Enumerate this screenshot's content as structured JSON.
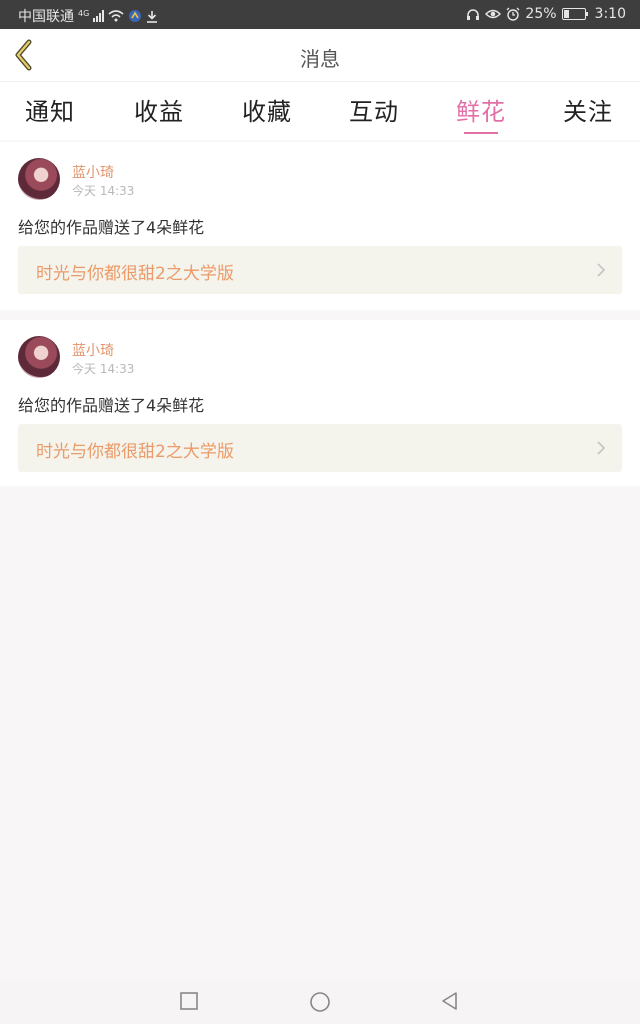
{
  "status_bar": {
    "carrier": "中国联通",
    "network": "4G",
    "battery_percent": "25%",
    "time": "3:10",
    "icons": [
      "signal-icon",
      "wifi-icon",
      "app-icon",
      "download-icon",
      "headphone-icon",
      "eye-icon",
      "alarm-icon",
      "battery-icon"
    ]
  },
  "header": {
    "title": "消息",
    "back_icon": "back-arrow-icon"
  },
  "tabs": [
    {
      "label": "通知"
    },
    {
      "label": "收益"
    },
    {
      "label": "收藏"
    },
    {
      "label": "互动"
    },
    {
      "label": "鲜花",
      "active": true
    },
    {
      "label": "关注"
    }
  ],
  "messages": [
    {
      "username": "蓝小琦",
      "time": "今天 14:33",
      "text": "给您的作品赠送了4朵鲜花",
      "work_title": "时光与你都很甜2之大学版"
    },
    {
      "username": "蓝小琦",
      "time": "今天 14:33",
      "text": "给您的作品赠送了4朵鲜花",
      "work_title": "时光与你都很甜2之大学版"
    }
  ],
  "nav_bar": {
    "icons": [
      "recent-apps-icon",
      "home-icon",
      "back-icon"
    ]
  },
  "colors": {
    "accent": "#e26fa6",
    "username": "#e3946b",
    "work_title": "#eb9b69",
    "work_bg": "#f4f3ec"
  }
}
